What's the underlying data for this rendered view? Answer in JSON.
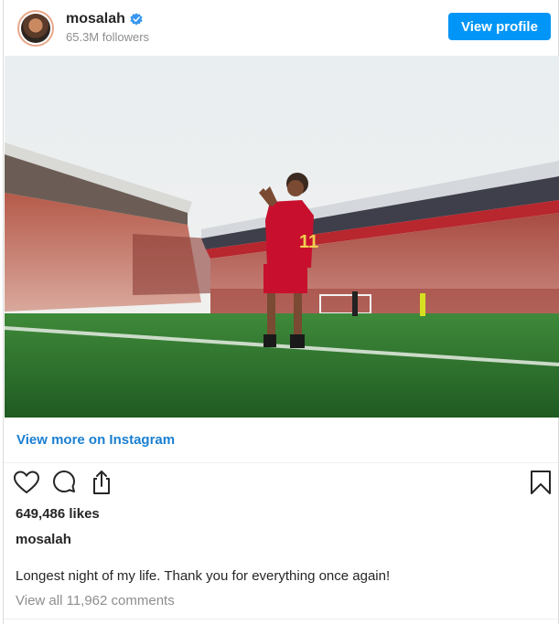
{
  "header": {
    "username": "mosalah",
    "followers": "65.3M followers",
    "view_profile_label": "View profile",
    "verified_color": "#3897f0",
    "button_color": "#0095f6"
  },
  "post": {
    "image_description": "Player in red Liverpool kit number 11 applauding on pitch in front of stadium crowd",
    "view_more_label": "View more on Instagram",
    "likes": "649,486 likes",
    "username": "mosalah",
    "caption": "Longest night of my life. Thank you for everything once again!",
    "comments": "View all 11,962 comments"
  },
  "icons": [
    "heart-icon",
    "comment-icon",
    "share-icon",
    "bookmark-icon"
  ]
}
